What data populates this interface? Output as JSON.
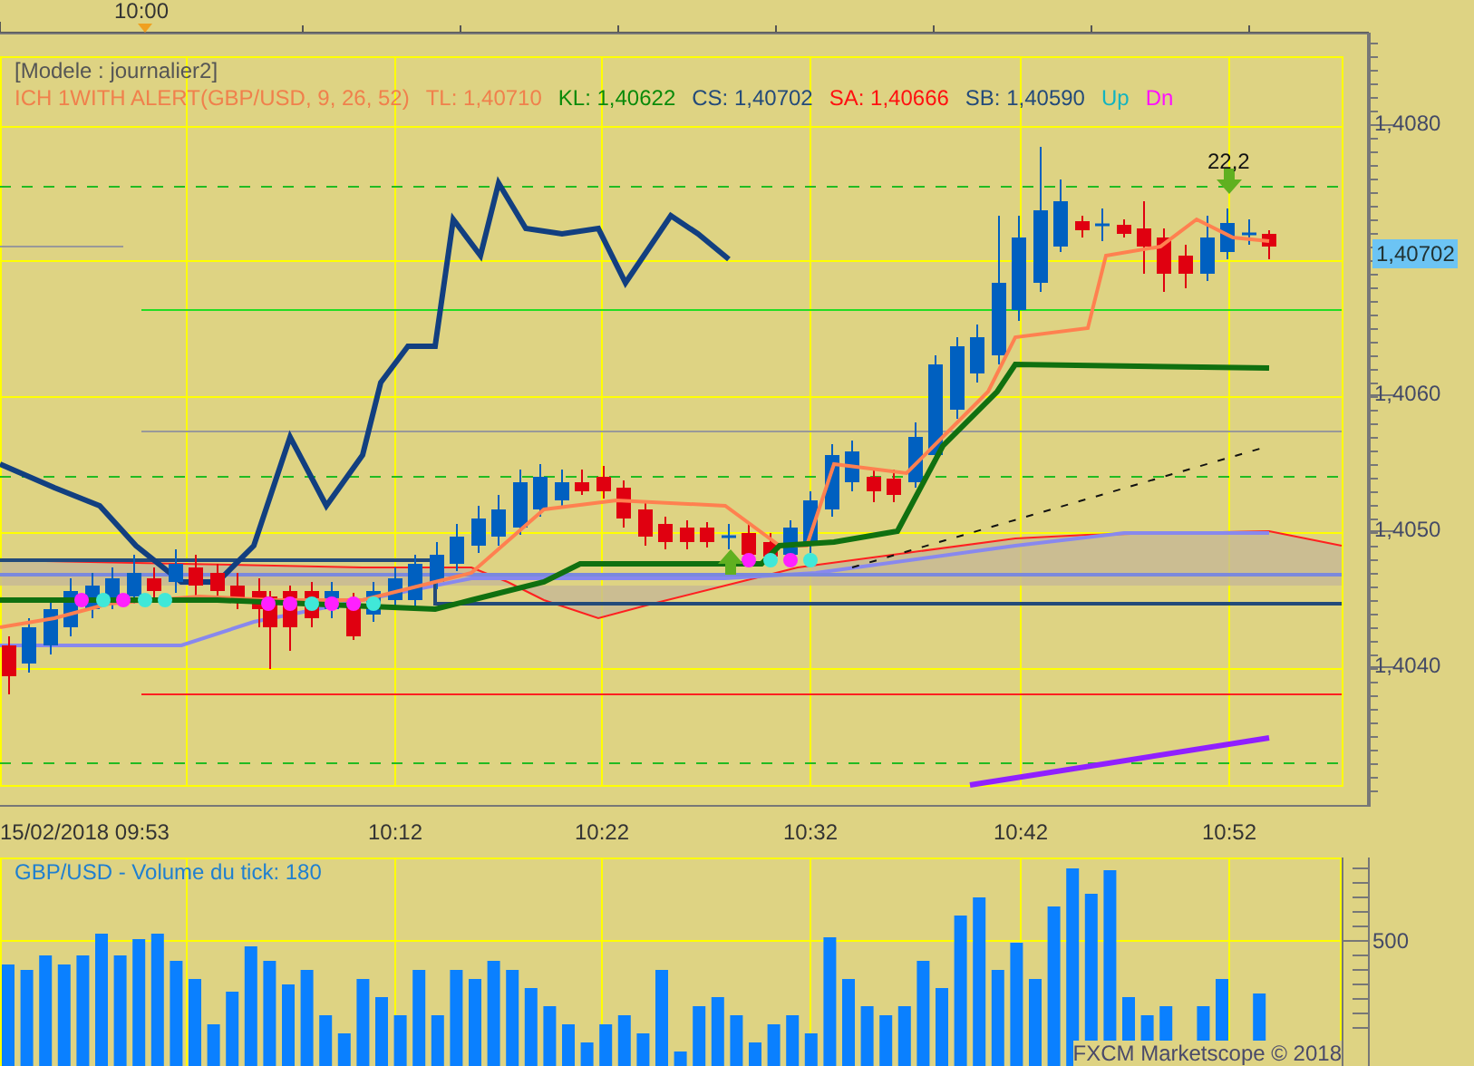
{
  "top_axis": {
    "marker_label": "10:00"
  },
  "legend": {
    "title": "[Modele : journalier2]",
    "items": [
      {
        "text": "ICH 1WITH ALERT(GBP/USD, 9, 26, 52)",
        "color": "#f0804c"
      },
      {
        "text": "TL: 1,40710",
        "color": "#f0804c"
      },
      {
        "text": "KL: 1,40622",
        "color": "#0a8a0a"
      },
      {
        "text": "CS: 1,40702",
        "color": "#234a7a"
      },
      {
        "text": "SA: 1,40666",
        "color": "#ff1010"
      },
      {
        "text": "SB: 1,40590",
        "color": "#234a7a"
      },
      {
        "text": "Up",
        "color": "#12b4c0"
      },
      {
        "text": "Dn",
        "color": "#ff10ff"
      }
    ]
  },
  "signal_label": "22,2",
  "price_axis": {
    "labels": [
      "1,4080",
      "1,4060",
      "1,4050",
      "1,4040"
    ],
    "current_price": "1,40702"
  },
  "time_axis": {
    "labels": [
      "15/02/2018 09:53",
      "10:12",
      "10:22",
      "10:32",
      "10:42",
      "10:52"
    ]
  },
  "volume_panel": {
    "title": "GBP/USD - Volume du tick: 180",
    "axis_label": "500",
    "credit": "FXCM Marketscope © 2018"
  }
}
